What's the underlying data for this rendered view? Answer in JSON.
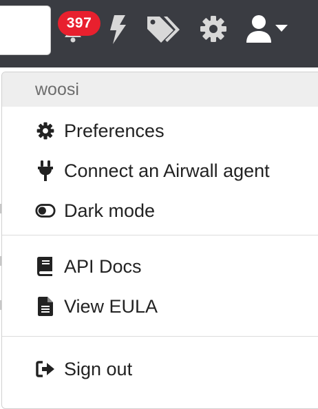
{
  "topbar": {
    "notification_count": "397"
  },
  "menu": {
    "username": "woosi",
    "items": [
      {
        "label": "Preferences",
        "icon": "gear-icon"
      },
      {
        "label": "Connect an Airwall agent",
        "icon": "plug-icon"
      },
      {
        "label": "Dark mode",
        "icon": "toggle-icon"
      },
      {
        "label": "API Docs",
        "icon": "book-icon"
      },
      {
        "label": "View EULA",
        "icon": "file-text-icon"
      },
      {
        "label": "Sign out",
        "icon": "sign-out-icon"
      }
    ]
  },
  "colors": {
    "topbar": "#3a3c42",
    "badge": "#e8202e",
    "icon": "#d8d8d8",
    "menu_header_bg": "#eeeeee"
  }
}
